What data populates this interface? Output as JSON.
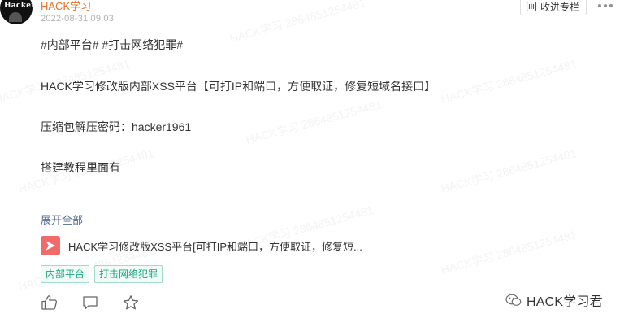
{
  "author": {
    "name": "HACK学习",
    "avatar_text": "Hacker"
  },
  "post": {
    "timestamp": "2022-08-31 09:03",
    "tags_line": "#内部平台# #打击网络犯罪#",
    "paragraphs": [
      "HACK学习修改版内部XSS平台【可打IP和端口，方便取证，修复短域名接口】",
      "压缩包解压密码：hacker1961",
      "搭建教程里面有"
    ],
    "expand_label": "展开全部",
    "article_title": "HACK学习修改版XSS平台[可打IP和端口，方便取证，修复短...",
    "tags": [
      "内部平台",
      "打击网络犯罪"
    ]
  },
  "toolbar": {
    "collect_label": "收进专栏"
  },
  "watermark": {
    "brand": "HACK学习君",
    "tile_text": "HACK学习 2864851254481"
  },
  "colors": {
    "author": "#e8702a",
    "link": "#576b95",
    "tag_green": "#19a77f",
    "article_icon_red": "#f06a6a"
  }
}
